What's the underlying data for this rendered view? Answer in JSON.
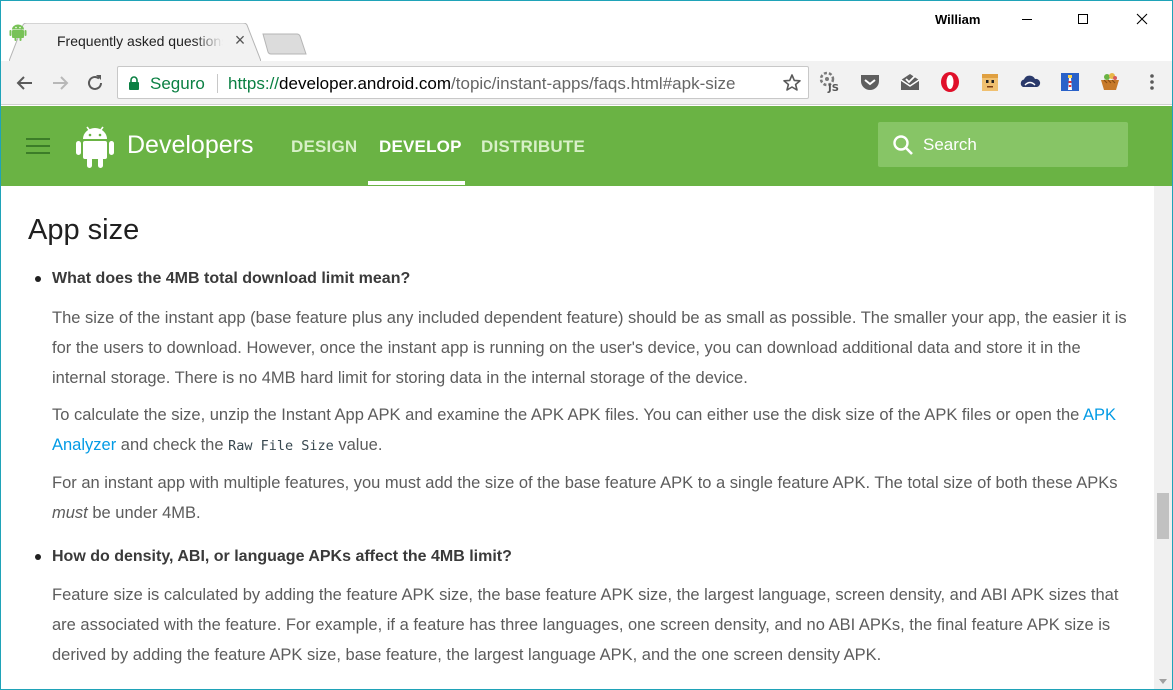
{
  "browser": {
    "tab_title": "Frequently asked questions",
    "user_name": "William",
    "secure_label": "Seguro",
    "url_scheme": "https://",
    "url_host": "developer.android.com",
    "url_path": "/topic/instant-apps/faqs.html#apk-size",
    "extensions": [
      "javascript-toggle-icon",
      "pocket-icon",
      "mail-check-icon",
      "opera-icon",
      "robot-face-icon",
      "cloud-icon",
      "lighthouse-icon",
      "basket-icon"
    ]
  },
  "header": {
    "brand": "Developers",
    "nav": {
      "design": "DESIGN",
      "develop": "DEVELOP",
      "distribute": "DISTRIBUTE"
    },
    "search_label": "Search"
  },
  "content": {
    "heading": "App size",
    "faq1": {
      "question": "What does the 4MB total download limit mean?",
      "p1": "The size of the instant app (base feature plus any included dependent feature) should be as small as possible. The smaller your app, the easier it is for the users to download. However, once the instant app is running on the user's device, you can download additional data and store it in the internal storage. There is no 4MB hard limit for storing data in the internal storage of the device.",
      "p2_part1": "To calculate the size, unzip the Instant App APK and examine the APK APK files. You can either use the disk size of the APK files or open the ",
      "p2_link": "APK Analyzer",
      "p2_part2": " and check the ",
      "p2_code": "Raw File Size",
      "p2_part3": " value.",
      "p3_part1": "For an instant app with multiple features, you must add the size of the base feature APK to a single feature APK. The total size of both these APKs ",
      "p3_em": "must",
      "p3_part2": " be under 4MB."
    },
    "faq2": {
      "question": "How do density, ABI, or language APKs affect the 4MB limit?",
      "p1": "Feature size is calculated by adding the feature APK size, the base feature APK size, the largest language, screen density, and ABI APK sizes that are associated with the feature. For example, if a feature has three languages, one screen density, and no ABI APKs, the final feature APK size is derived by adding the feature APK size, base feature, the largest language APK, and the one screen density APK."
    }
  },
  "colors": {
    "header_green": "#6ab344",
    "link_blue": "#039be5",
    "secure_green": "#0b8043",
    "window_border": "#1fa3b8"
  }
}
